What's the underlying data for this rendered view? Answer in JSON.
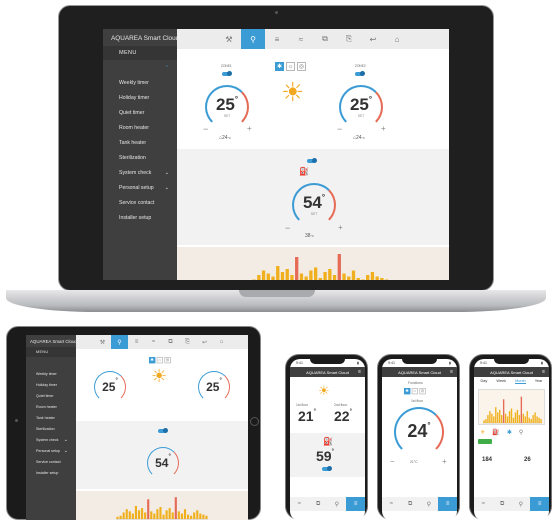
{
  "app": {
    "title": "AQUAREA Smart Cloud",
    "menu_label": "MENU",
    "menu_items": [
      {
        "label": "Weekly timer",
        "chevron": false,
        "active": false
      },
      {
        "label": "Holiday timer",
        "chevron": false,
        "active": false
      },
      {
        "label": "Quiet timer",
        "chevron": false,
        "active": false
      },
      {
        "label": "Room heater",
        "chevron": false,
        "active": false
      },
      {
        "label": "Tank heater",
        "chevron": false,
        "active": false
      },
      {
        "label": "Sterilization",
        "chevron": false,
        "active": false
      },
      {
        "label": "System check",
        "chevron": true,
        "active": false
      },
      {
        "label": "Personal setup",
        "chevron": true,
        "active": false
      },
      {
        "label": "Service contact",
        "chevron": false,
        "active": false
      },
      {
        "label": "Installer setup",
        "chevron": false,
        "active": false
      }
    ],
    "tabs": [
      "⚒",
      "⚲",
      "≡",
      "≈",
      "⧉",
      "⎘",
      "↩",
      "⌂"
    ],
    "active_tab": 1,
    "accent": "#3a9bd5",
    "heat_color": "#e56b57"
  },
  "zones": {
    "zone1_label": "ZONE1",
    "zone2_label": "ZONE2",
    "zone1_temp": "25",
    "zone2_temp": "25",
    "degree": "°",
    "set_label": "SET",
    "zone1_outdoor": "24",
    "zone2_outdoor": "24",
    "outdoor_unit": "°C",
    "minus": "−",
    "plus": "+"
  },
  "tank": {
    "temp": "54",
    "set_label": "SET",
    "current": "38"
  },
  "phones": {
    "p1_title": "AQUAREA Smart Cloud",
    "p1_zone1_temp": "21",
    "p1_zone2_temp": "22",
    "p1_tank_temp": "59",
    "p1_zone1_name": "1st floor",
    "p1_zone2_name": "2nd floor",
    "p1_time": "9:41",
    "p2_title": "AQUAREA Smart Cloud",
    "p2_functions": "Functions",
    "p2_zone": "1st floor",
    "p2_temp": "24",
    "p2_current": "21°C",
    "p3_title": "AQUAREA Smart Cloud",
    "p3_tabs": [
      "Day",
      "Week",
      "Month",
      "Year"
    ],
    "p3_active_tab": "Month",
    "p3_value1": "184",
    "p3_value2": "26"
  },
  "chart_data": {
    "type": "bar",
    "title": "",
    "xlabel": "",
    "ylabel": "",
    "categories": [
      "1",
      "2",
      "3",
      "4",
      "5",
      "6",
      "7",
      "8",
      "9",
      "10",
      "11",
      "12",
      "13",
      "14",
      "15",
      "16",
      "17",
      "18",
      "19",
      "20",
      "21",
      "22",
      "23",
      "24",
      "25",
      "26",
      "27",
      "28",
      "29",
      "30"
    ],
    "series": [
      {
        "values": [
          2,
          3,
          6,
          9,
          7,
          5,
          12,
          8,
          10,
          6,
          18,
          7,
          5,
          9,
          11,
          4,
          8,
          10,
          6,
          20,
          7,
          5,
          9,
          4,
          3,
          6,
          8,
          5,
          4,
          3
        ]
      }
    ],
    "highlight_color": "#e56b57",
    "bar_color": "#f0b01e",
    "ylim": [
      0,
      22
    ]
  }
}
